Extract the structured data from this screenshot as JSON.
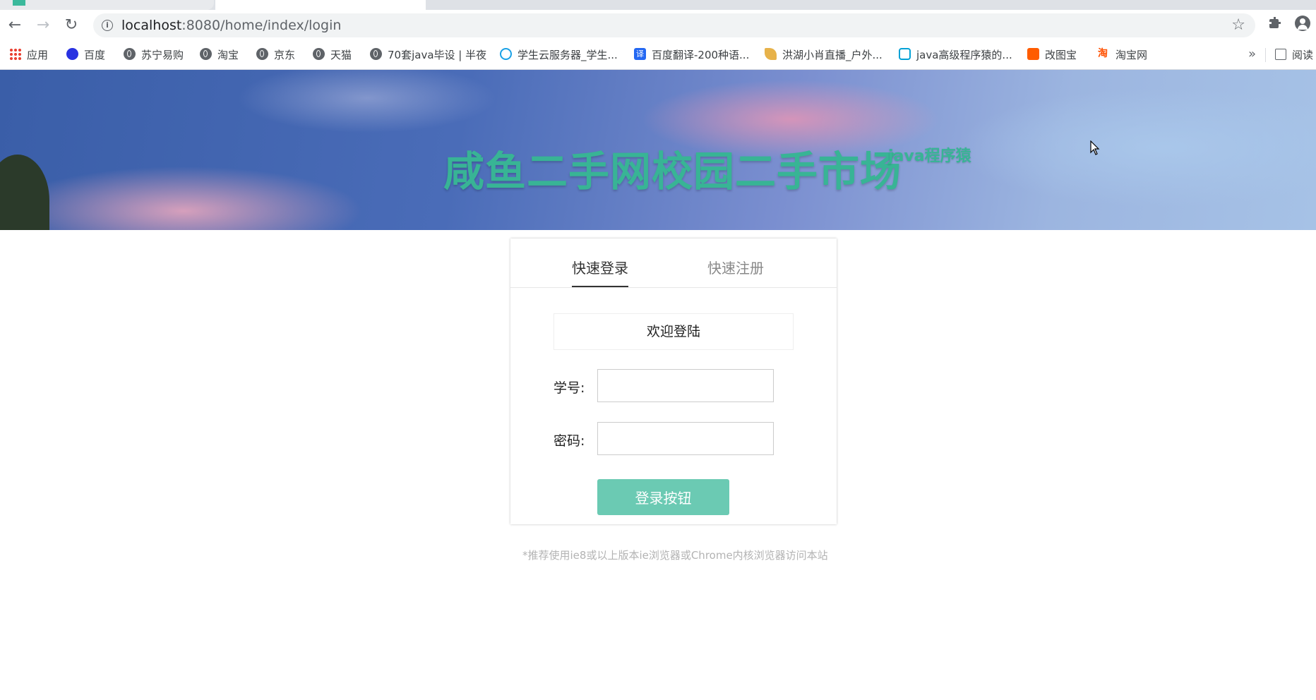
{
  "browser": {
    "url_host": "localhost",
    "url_path": ":8080/home/index/login",
    "bookmarks": [
      {
        "label": "应用",
        "icon": "apps-icon"
      },
      {
        "label": "百度",
        "icon": "baidu-icon"
      },
      {
        "label": "苏宁易购",
        "icon": "globe-icon"
      },
      {
        "label": "淘宝",
        "icon": "globe-icon"
      },
      {
        "label": "京东",
        "icon": "globe-icon"
      },
      {
        "label": "天猫",
        "icon": "globe-icon"
      },
      {
        "label": "70套java毕设 | 半夜",
        "icon": "globe-icon"
      },
      {
        "label": "学生云服务器_学生...",
        "icon": "cloud-icon"
      },
      {
        "label": "百度翻译-200种语...",
        "icon": "fanyi-icon"
      },
      {
        "label": "洪湖小肖直播_户外...",
        "icon": "feather-icon"
      },
      {
        "label": "java高级程序猿的...",
        "icon": "bilibili-icon"
      },
      {
        "label": "改图宝",
        "icon": "gaitubao-icon"
      },
      {
        "label": "淘宝网",
        "icon": "taobao-icon"
      }
    ],
    "more_label": "»",
    "reader_label": "阅读"
  },
  "banner": {
    "title": "咸鱼二手网校园二手市场",
    "subtitle": "java程序猿"
  },
  "login": {
    "tabs": [
      "快速登录",
      "快速注册"
    ],
    "welcome": "欢迎登陆",
    "student_id_label": "学号:",
    "password_label": "密码:",
    "student_id_value": "",
    "password_value": "",
    "submit_label": "登录按钮"
  },
  "footnote": "*推荐使用ie8或以上版本ie浏览器或Chrome内核浏览器访问本站",
  "colors": {
    "accent": "#38b495",
    "button": "#6bcab3"
  }
}
